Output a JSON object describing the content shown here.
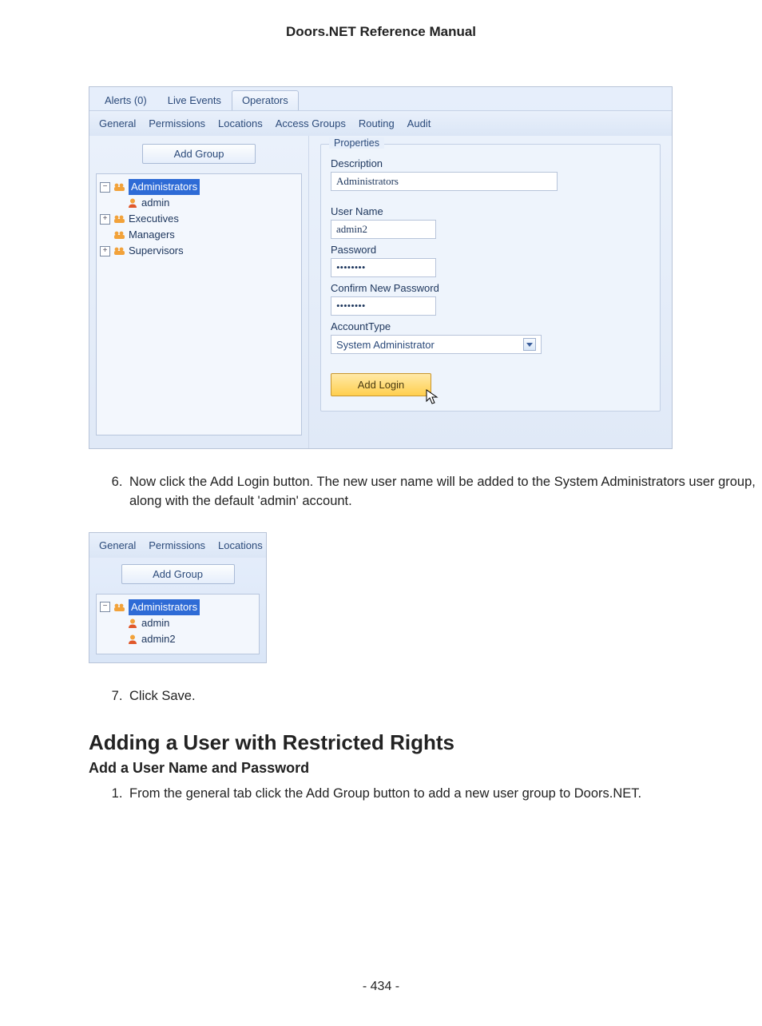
{
  "doc": {
    "title": "Doors.NET Reference Manual",
    "step6": "Now click the Add Login button. The new user name will be added to the System Administrators user group, along with the default 'admin' account.",
    "step7": "Click Save.",
    "h2": "Adding a User with Restricted Rights",
    "h3": "Add a User Name and Password",
    "step1": "From the general tab click the Add Group button to add a new user group to Doors.NET.",
    "page": "- 434 -"
  },
  "app1": {
    "tabs": {
      "alerts": "Alerts (0)",
      "live": "Live Events",
      "operators": "Operators"
    },
    "subtabs": {
      "general": "General",
      "permissions": "Permissions",
      "locations": "Locations",
      "access": "Access Groups",
      "routing": "Routing",
      "audit": "Audit"
    },
    "addGroup": "Add Group",
    "tree": {
      "administrators": "Administrators",
      "admin": "admin",
      "executives": "Executives",
      "managers": "Managers",
      "supervisors": "Supervisors"
    },
    "props": {
      "title": "Properties",
      "descLabel": "Description",
      "desc": "Administrators",
      "userLabel": "User Name",
      "user": "admin2",
      "pwLabel": "Password",
      "pw": "••••••••",
      "cpwLabel": "Confirm New Password",
      "cpw": "••••••••",
      "atLabel": "AccountType",
      "at": "System Administrator",
      "addLogin": "Add Login"
    }
  },
  "app2": {
    "subtabs": {
      "general": "General",
      "permissions": "Permissions",
      "locations": "Locations"
    },
    "addGroup": "Add Group",
    "tree": {
      "administrators": "Administrators",
      "admin": "admin",
      "admin2": "admin2"
    }
  }
}
